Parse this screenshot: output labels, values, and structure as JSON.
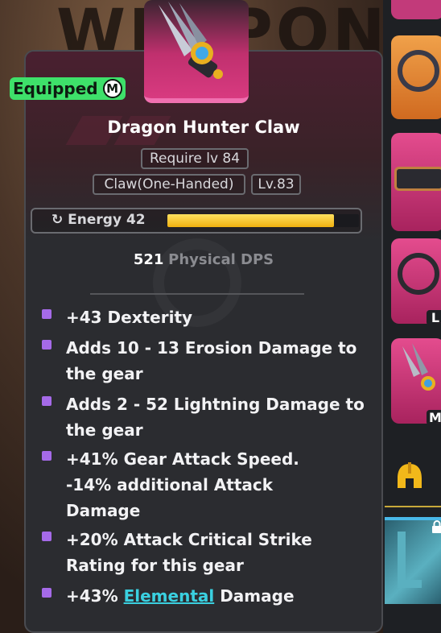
{
  "background": {
    "title_word": "WEAPON"
  },
  "tooltip": {
    "equipped_label": "Equipped",
    "equipped_badge": "M",
    "item_name": "Dragon Hunter Claw",
    "require_level": "Require lv 84",
    "item_type": "Claw(One-Handed)",
    "item_level": "Lv.83",
    "energy": {
      "label": "Energy 42",
      "fill_fraction": 0.87,
      "color": "#f5c518"
    },
    "dps": {
      "value": "521",
      "label": "Physical DPS"
    },
    "affixes": [
      {
        "text": "+43 Dexterity"
      },
      {
        "text": "Adds 10 - 13 Erosion Damage to the gear"
      },
      {
        "text": "Adds 2 - 52 Lightning Damage to the gear"
      },
      {
        "text": "+41% Gear Attack Speed. -14% additional Attack Damage"
      },
      {
        "text": "+20% Attack Critical Strike Rating for this gear"
      },
      {
        "prefix": "+43% ",
        "keyword": "Elemental",
        "suffix": " Damage"
      }
    ],
    "colors": {
      "equipped": "#3ee06a",
      "bullet": "#a56ae8",
      "keyword": "#3ad0e0",
      "rarity": "#d83a80"
    }
  },
  "sidebar": {
    "slots": [
      {
        "id": "slot-top",
        "tag": ""
      },
      {
        "id": "slot-necklace",
        "tag": ""
      },
      {
        "id": "slot-belt",
        "tag": ""
      },
      {
        "id": "slot-ring-left",
        "tag": "L"
      },
      {
        "id": "slot-claw-main",
        "tag": "M"
      }
    ],
    "icons": [
      "spartan-helmet-icon",
      "lock-icon"
    ]
  }
}
